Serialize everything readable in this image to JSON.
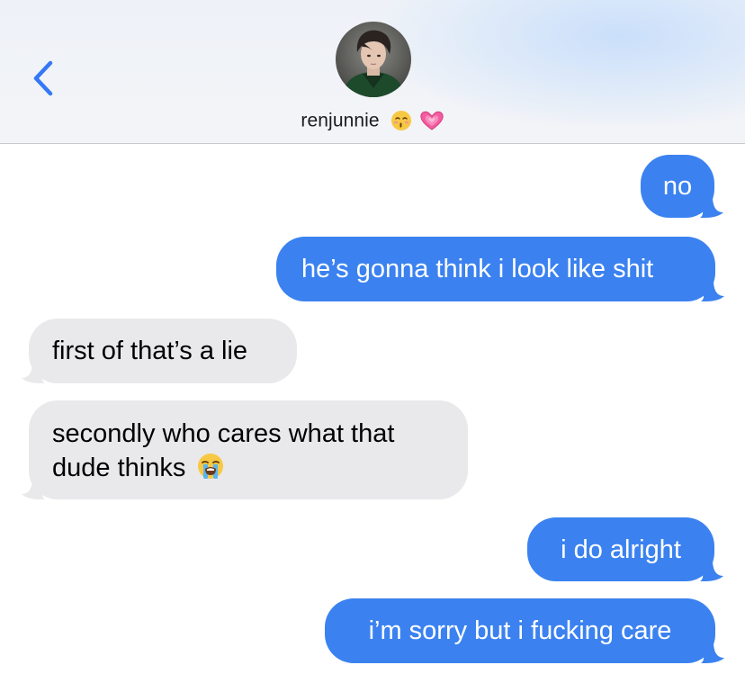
{
  "header": {
    "contact_name": "renjunnie",
    "name_emojis": [
      "kissing-face-emoji",
      "growing-heart-emoji"
    ],
    "back_icon": "chevron-left-icon",
    "accent_color": "#3478f6"
  },
  "messages": [
    {
      "side": "sent",
      "text": "no"
    },
    {
      "side": "sent",
      "text": "he’s gonna think i look like shit"
    },
    {
      "side": "received",
      "text": "first of that’s a lie"
    },
    {
      "side": "received",
      "text_line1": "secondly who cares what that",
      "text_line2": "dude thinks",
      "emoji": "loudly-crying-face-emoji"
    },
    {
      "side": "sent",
      "text": "i do alright"
    },
    {
      "side": "sent",
      "text": "i’m sorry but i fucking care"
    }
  ],
  "colors": {
    "sent_bubble": "#3b82f0",
    "received_bubble": "#e9e9eb",
    "header_bg": "#f2f3f7"
  }
}
